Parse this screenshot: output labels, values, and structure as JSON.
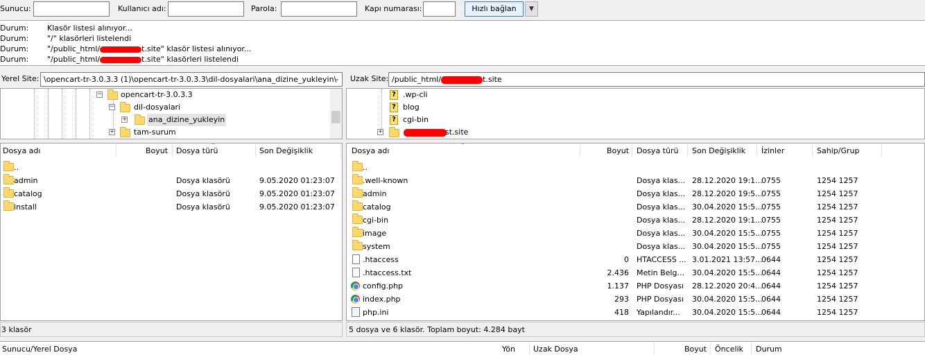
{
  "quickconnect": {
    "host_label": "Sunucu:",
    "host_value": "",
    "user_label": "Kullanıcı adı:",
    "user_value": "",
    "pass_label": "Parola:",
    "pass_value": "",
    "port_label": "Kapı numarası:",
    "port_value": "",
    "connect_label": "Hızlı bağlan"
  },
  "log": [
    {
      "key": "Durum:",
      "text": "Klasör listesi alınıyor..."
    },
    {
      "key": "Durum:",
      "text": "\"/\" klasörleri listelendi"
    },
    {
      "key": "Durum:",
      "text_pre": "\"/public_html/",
      "text_post": "t.site\" klasör listesi alınıyor..."
    },
    {
      "key": "Durum:",
      "text_pre": "\"/public_html/",
      "text_post": "t.site\" klasörleri listelendi"
    }
  ],
  "local": {
    "label": "Yerel Site:",
    "path": "\\opencart-tr-3.0.3.3 (1)\\opencart-tr-3.0.3.3\\dil-dosyalari\\ana_dizine_yukleyin\\",
    "tree": [
      "opencart-tr-3.0.3.3",
      "dil-dosyalari",
      "ana_dizine_yukleyin",
      "tam-surum"
    ],
    "columns": [
      "Dosya adı",
      "Boyut",
      "Dosya türü",
      "Son Değişiklik"
    ],
    "rows": [
      {
        "name": "..",
        "size": "",
        "type": "",
        "modified": ""
      },
      {
        "name": "admin",
        "size": "",
        "type": "Dosya klasörü",
        "modified": "9.05.2020 01:23:07"
      },
      {
        "name": "catalog",
        "size": "",
        "type": "Dosya klasörü",
        "modified": "9.05.2020 01:23:07"
      },
      {
        "name": "install",
        "size": "",
        "type": "Dosya klasörü",
        "modified": "9.05.2020 01:23:07"
      }
    ],
    "status": "3 klasör"
  },
  "remote": {
    "label": "Uzak Site:",
    "path_pre": "/public_html/",
    "path_post": "t.site",
    "tree": [
      ".wp-cli",
      "blog",
      "cgi-bin",
      "st.site"
    ],
    "columns": [
      "Dosya adı",
      "Boyut",
      "Dosya türü",
      "Son Değişiklik",
      "İzinler",
      "Sahip/Grup"
    ],
    "rows": [
      {
        "name": "..",
        "size": "",
        "type": "",
        "modified": "",
        "perm": "",
        "owner": "",
        "icon": "folder"
      },
      {
        "name": ".well-known",
        "size": "",
        "type": "Dosya klas...",
        "modified": "28.12.2020 19:1...",
        "perm": "0755",
        "owner": "1254 1257",
        "icon": "folder"
      },
      {
        "name": "admin",
        "size": "",
        "type": "Dosya klas...",
        "modified": "28.12.2020 19:5...",
        "perm": "0755",
        "owner": "1254 1257",
        "icon": "folder"
      },
      {
        "name": "catalog",
        "size": "",
        "type": "Dosya klas...",
        "modified": "30.04.2020 15:5...",
        "perm": "0755",
        "owner": "1254 1257",
        "icon": "folder"
      },
      {
        "name": "cgi-bin",
        "size": "",
        "type": "Dosya klas...",
        "modified": "28.12.2020 19:1...",
        "perm": "0755",
        "owner": "1254 1257",
        "icon": "folder"
      },
      {
        "name": "image",
        "size": "",
        "type": "Dosya klas...",
        "modified": "30.04.2020 15:5...",
        "perm": "0755",
        "owner": "1254 1257",
        "icon": "folder"
      },
      {
        "name": "system",
        "size": "",
        "type": "Dosya klas...",
        "modified": "30.04.2020 15:5...",
        "perm": "0755",
        "owner": "1254 1257",
        "icon": "folder"
      },
      {
        "name": ".htaccess",
        "size": "0",
        "type": "HTACCESS ...",
        "modified": "3.01.2021 13:57...",
        "perm": "0644",
        "owner": "1254 1257",
        "icon": "doc"
      },
      {
        "name": ".htaccess.txt",
        "size": "2.436",
        "type": "Metin Belg...",
        "modified": "30.04.2020 15:5...",
        "perm": "0644",
        "owner": "1254 1257",
        "icon": "doc"
      },
      {
        "name": "config.php",
        "size": "1.137",
        "type": "PHP Dosyası",
        "modified": "28.12.2020 20:4...",
        "perm": "0644",
        "owner": "1254 1257",
        "icon": "chrome"
      },
      {
        "name": "index.php",
        "size": "293",
        "type": "PHP Dosyası",
        "modified": "30.04.2020 15:5...",
        "perm": "0644",
        "owner": "1254 1257",
        "icon": "chrome"
      },
      {
        "name": "php.ini",
        "size": "418",
        "type": "Yapılandır...",
        "modified": "30.04.2020 15:5...",
        "perm": "0644",
        "owner": "1254 1257",
        "icon": "ini"
      }
    ],
    "status": "5 dosya ve 6 klasör. Toplam boyut: 4.284 bayt"
  },
  "queue": {
    "columns": [
      "Sunucu/Yerel Dosya",
      "Yön",
      "Uzak Dosya",
      "Boyut",
      "Öncelik",
      "Durum"
    ]
  },
  "colors": {
    "accent": "#3c7fb1",
    "folder": "#ffd86b",
    "redact": "#ff0000"
  }
}
